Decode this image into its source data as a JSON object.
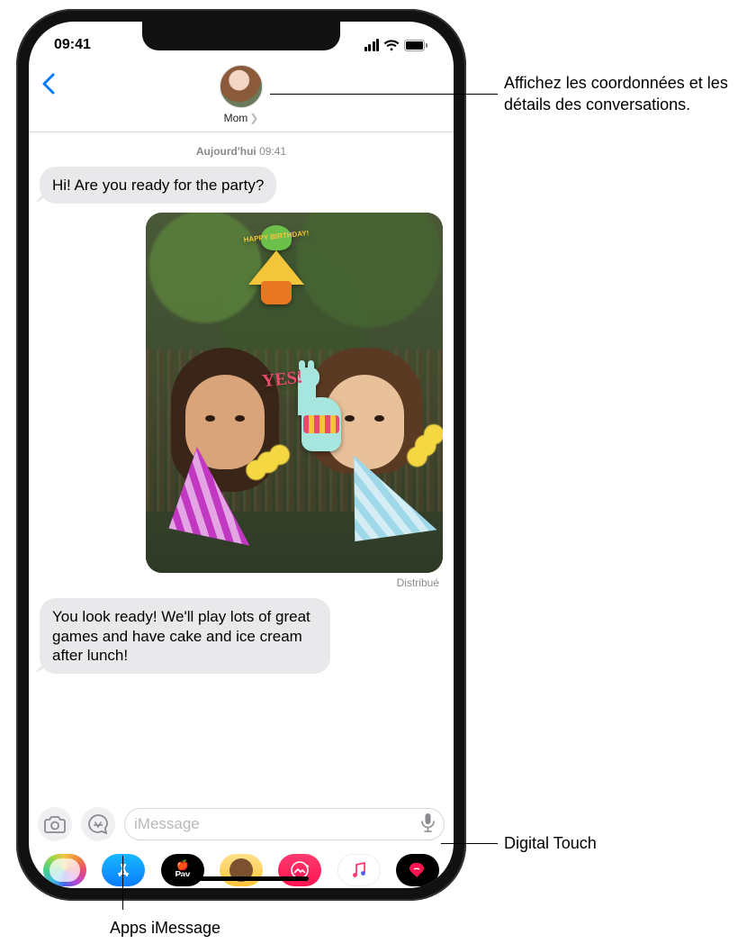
{
  "status": {
    "time": "09:41"
  },
  "nav": {
    "contact_name": "Mom"
  },
  "thread": {
    "timestamp_label": "Aujourd'hui",
    "timestamp_time": "09:41",
    "msg1": "Hi! Are you ready for the party?",
    "delivered_label": "Distribué",
    "msg2": "You look ready! We'll play lots of great games and have cake and ice cream after lunch!",
    "sticker_happy_birthday": "HAPPY BIRTHDAY!",
    "sticker_yes": "YES!"
  },
  "input": {
    "placeholder": "iMessage"
  },
  "apps": {
    "pay_label": "Pay"
  },
  "callouts": {
    "contact": "Affichez les coordonnées et les détails des conversations.",
    "digital_touch": "Digital Touch",
    "imessage_apps": "Apps iMessage"
  }
}
